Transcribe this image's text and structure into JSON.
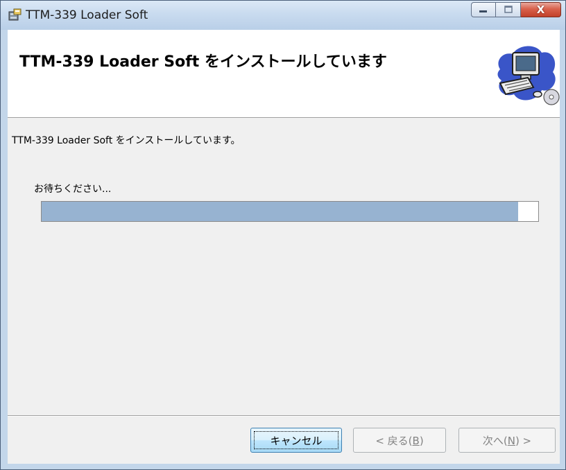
{
  "window": {
    "title": "TTM-339 Loader Soft",
    "close_glyph": "X"
  },
  "banner": {
    "title": "TTM-339 Loader Soft をインストールしています",
    "art_icon": "computer-install-icon"
  },
  "body": {
    "status_text": "TTM-339 Loader Soft をインストールしています。",
    "wait_label": "お待ちください...",
    "progress_fraction": 0.96
  },
  "buttons": {
    "cancel": "キャンセル",
    "back_prefix": "< 戻る(",
    "back_key": "B",
    "back_suffix": ")",
    "next_prefix": "次へ(",
    "next_key": "N",
    "next_suffix": ") >"
  },
  "colors": {
    "progress_fill": "#97b3d1",
    "titlebar": "#c9dbef",
    "close_button": "#c2412a"
  }
}
